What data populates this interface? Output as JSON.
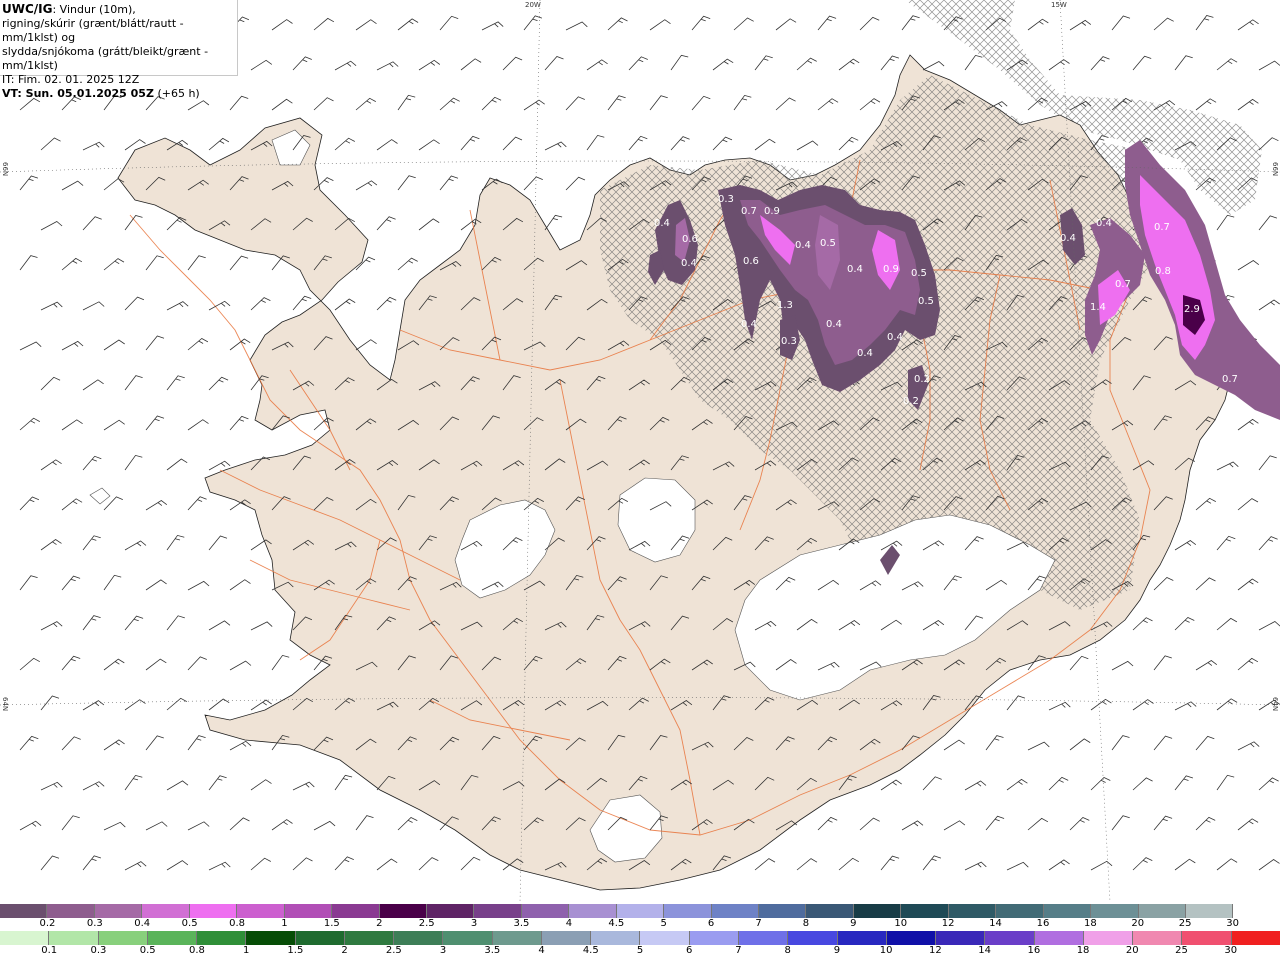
{
  "header": {
    "model": "UWC/IG",
    "line1_rest": ": Vindur (10m),",
    "line2": "rigning/skúrir (grænt/blátt/rautt - mm/1klst) og",
    "line3": "slydda/snjókoma (grátt/bleikt/grænt - mm/1klst)",
    "it": "IT: Fim. 02. 01. 2025 12Z",
    "vt": "VT: Sun. 05.01.2025 05Z",
    "lead": "(+65 h)"
  },
  "grid_labels": {
    "lon_20w": "20W",
    "lon_15w": "15W",
    "lat_66n_left": "66N",
    "lat_66n_right": "66N",
    "lat_64n_left": "64N",
    "lat_64n_right": "64N"
  },
  "precip_values": [
    "0.4",
    "0.6",
    "0.4",
    "0.3",
    "0.7",
    "0.9",
    "0.4",
    "0.5",
    "0.6",
    "0.4",
    "0.9",
    "0.5",
    "0.5",
    "1.3",
    "0.4",
    "0.4",
    "0.3",
    "0.4",
    "0.4",
    "0.2",
    "0.2",
    "0.4",
    "0.4",
    "0.7",
    "0.7",
    "0.8",
    "1.4",
    "2.9",
    "0.7"
  ],
  "legend_snow": {
    "colors": [
      "#6b4f6e",
      "#8e5d8e",
      "#a56aa6",
      "#d16fd4",
      "#ee6ff0",
      "#cc5fcf",
      "#b14eb6",
      "#8a3a92",
      "#4a0049",
      "#5f2466",
      "#78408a",
      "#8f61ad",
      "#a890d2",
      "#b3b1ea",
      "#8c93db",
      "#6e82c6",
      "#4f6c9e",
      "#3a5876",
      "#183c46",
      "#1f4a56",
      "#2f5a66",
      "#426b76",
      "#567e88",
      "#6d9096",
      "#8aa2a4",
      "#b4c2c2",
      "#ffffff"
    ],
    "labels": [
      "0.2",
      "0.3",
      "0.4",
      "0.5",
      "0.8",
      "1",
      "1.5",
      "2",
      "2.5",
      "3",
      "3.5",
      "4",
      "4.5",
      "5",
      "6",
      "7",
      "8",
      "9",
      "10",
      "12",
      "14",
      "16",
      "18",
      "20",
      "25",
      "30"
    ]
  },
  "legend_rain": {
    "colors": [
      "#d8f5d0",
      "#b2e6a8",
      "#88d07c",
      "#5ab45a",
      "#2f8f38",
      "#064d06",
      "#1f6b2f",
      "#2f7a40",
      "#3d7e57",
      "#4f8f70",
      "#6e9a8e",
      "#8b9fb4",
      "#a9b8dc",
      "#c6c9f4",
      "#9a9cf0",
      "#6f70e8",
      "#4848e0",
      "#2828c0",
      "#1010a8",
      "#3a28b8",
      "#6a3ec8",
      "#b06ee0",
      "#f0a0e8",
      "#f088b0",
      "#f05070",
      "#f02020"
    ],
    "labels": [
      "0.1",
      "0.3",
      "0.5",
      "0.8",
      "1",
      "1.5",
      "2",
      "2.5",
      "3",
      "3.5",
      "4",
      "4.5",
      "5",
      "6",
      "7",
      "8",
      "9",
      "10",
      "12",
      "14",
      "16",
      "18",
      "20",
      "25",
      "30"
    ]
  }
}
